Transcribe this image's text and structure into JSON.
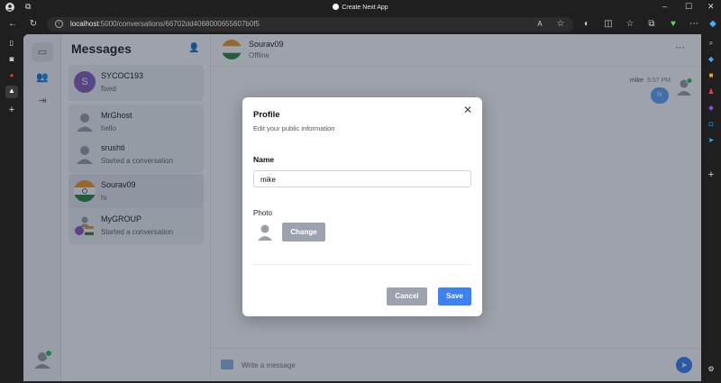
{
  "browser": {
    "window_title": "Create Next App",
    "url_host": "localhost",
    "url_path": ":5000/conversations/66702dd4068000655607b0f5"
  },
  "sidebar_nav": {
    "items": [
      "chat-icon",
      "contacts-icon",
      "logout-icon"
    ]
  },
  "messages_panel": {
    "title": "Messages",
    "conversations": [
      {
        "name": "SYCOC193",
        "last_message": "fixed",
        "avatar_letter": "S",
        "avatar_color": "#8b5fbf"
      },
      {
        "name": "MrGhost",
        "last_message": "hello"
      },
      {
        "name": "srushti",
        "last_message": "Started a conversation"
      },
      {
        "name": "Sourav09",
        "last_message": "hi"
      },
      {
        "name": "MyGROUP",
        "last_message": "Started a conversation"
      }
    ]
  },
  "chat": {
    "contact_name": "Sourav09",
    "contact_status": "Offline",
    "last_sender": "mike",
    "last_time": "5:57 PM",
    "last_message": "hi",
    "composer_placeholder": "Write a message"
  },
  "profile_modal": {
    "title": "Profile",
    "subtitle": "Edit your public information",
    "name_label": "Name",
    "name_value": "mike",
    "photo_label": "Photo",
    "change_button": "Change",
    "cancel_button": "Cancel",
    "save_button": "Save"
  },
  "colors": {
    "primary": "#3b82f6",
    "secondary_button": "#9ca3af",
    "overlay": "#162137"
  }
}
